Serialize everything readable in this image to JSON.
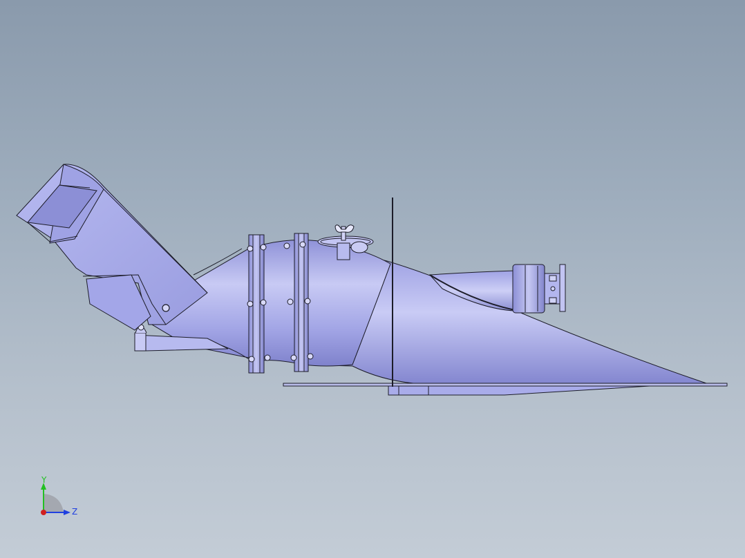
{
  "viewport": {
    "background_top": "#8a9aac",
    "background_bottom": "#c3ccd6",
    "model_color": "#a8abe8",
    "edge_color": "#1c1c28"
  },
  "triad": {
    "y_label": "Y",
    "z_label": "Z",
    "y_color": "#22c022",
    "z_color": "#2040e0",
    "x_color": "#d02020"
  }
}
